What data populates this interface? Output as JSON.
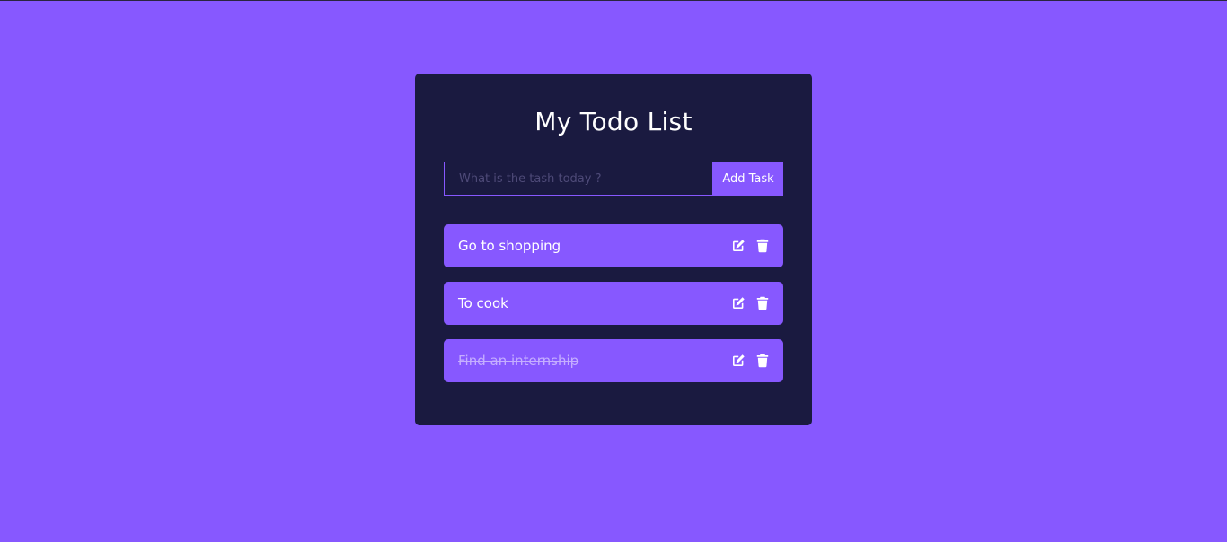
{
  "app": {
    "title": "My Todo List"
  },
  "form": {
    "placeholder": "What is the tash today ?",
    "value": "",
    "submit_label": "Add Task"
  },
  "todos": [
    {
      "text": "Go to shopping",
      "completed": false,
      "edit_icon": "edit-icon",
      "delete_icon": "trash-icon"
    },
    {
      "text": "To cook",
      "completed": false,
      "edit_icon": "edit-icon",
      "delete_icon": "trash-icon"
    },
    {
      "text": "Find an internship",
      "completed": true,
      "edit_icon": "edit-icon",
      "delete_icon": "trash-icon"
    }
  ],
  "colors": {
    "background": "#8758ff",
    "card": "#1a1a40",
    "accent": "#8758ff",
    "text": "#ffffff",
    "completed_text": "#c5aeff"
  }
}
